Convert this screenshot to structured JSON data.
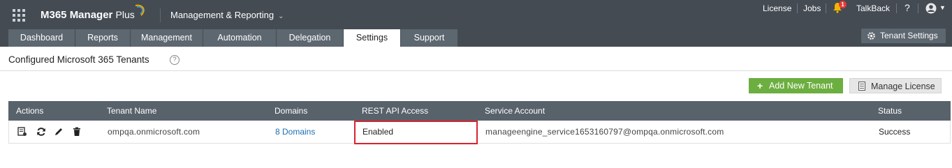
{
  "app": {
    "brand": "M365 Manager",
    "brand_plus": "Plus",
    "module": "Management & Reporting"
  },
  "top_links": {
    "license": "License",
    "jobs": "Jobs",
    "notification_count": "1",
    "talkback": "TalkBack",
    "help": "?"
  },
  "tabs": [
    {
      "label": "Dashboard",
      "active": false
    },
    {
      "label": "Reports",
      "active": false
    },
    {
      "label": "Management",
      "active": false
    },
    {
      "label": "Automation",
      "active": false
    },
    {
      "label": "Delegation",
      "active": false
    },
    {
      "label": "Settings",
      "active": true
    },
    {
      "label": "Support",
      "active": false
    }
  ],
  "tenant_settings_label": "Tenant Settings",
  "page": {
    "title": "Configured Microsoft 365 Tenants",
    "help": "?"
  },
  "buttons": {
    "add_tenant": "Add New Tenant",
    "manage_license": "Manage License"
  },
  "table": {
    "columns": [
      "Actions",
      "Tenant Name",
      "Domains",
      "REST API Access",
      "Service Account",
      "Status"
    ],
    "rows": [
      {
        "tenant_name": "ompqa.onmicrosoft.com",
        "domains": "8 Domains",
        "rest_api_access": "Enabled",
        "service_account": "manageengine_service1653160797@ompqa.onmicrosoft.com",
        "status": "Success"
      }
    ]
  },
  "colors": {
    "topbar": "#444b53",
    "tab_inactive": "#5d6770",
    "add_button": "#6dae40",
    "link": "#1a6fb5",
    "highlight": "#d9232e"
  }
}
